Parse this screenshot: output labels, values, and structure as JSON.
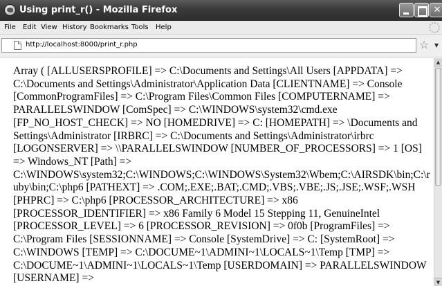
{
  "window": {
    "title": "Using print_r() - Mozilla Firefox"
  },
  "menu": {
    "items": [
      "File",
      "Edit",
      "View",
      "History",
      "Bookmarks",
      "Tools",
      "Help"
    ]
  },
  "address_bar": {
    "url": "http://localhost:8000/print_r.php"
  },
  "content": {
    "output": "Array ( [ALLUSERSPROFILE] => C:\\Documents and Settings\\All Users [APPDATA] => C:\\Documents and Settings\\Administrator\\Application Data [CLIENTNAME] => Console [CommonProgramFiles] => C:\\Program Files\\Common Files [COMPUTERNAME] => PARALLELSWINDOW [ComSpec] => C:\\WINDOWS\\system32\\cmd.exe [FP_NO_HOST_CHECK] => NO [HOMEDRIVE] => C: [HOMEPATH] => \\Documents and Settings\\Administrator [IRBRC] => C:\\Documents and Settings\\Administrator\\irbrc [LOGONSERVER] => \\\\PARALLELSWINDOW [NUMBER_OF_PROCESSORS] => 1 [OS] => Windows_NT [Path] => C:\\WINDOWS\\system32;C:\\WINDOWS;C:\\WINDOWS\\System32\\Wbem;C:\\AIRSDK\\bin;C:\\ruby\\bin;C:\\php6 [PATHEXT] => .COM;.EXE;.BAT;.CMD;.VBS;.VBE;.JS;.JSE;.WSF;.WSH [PHPRC] => C:\\php6 [PROCESSOR_ARCHITECTURE] => x86 [PROCESSOR_IDENTIFIER] => x86 Family 6 Model 15 Stepping 11, GenuineIntel [PROCESSOR_LEVEL] => 6 [PROCESSOR_REVISION] => 0f0b [ProgramFiles] => C:\\Program Files [SESSIONNAME] => Console [SystemDrive] => C: [SystemRoot] => C:\\WINDOWS [TEMP] => C:\\DOCUME~1\\ADMINI~1\\LOCALS~1\\Temp [TMP] => C:\\DOCUME~1\\ADMINI~1\\LOCALS~1\\Temp [USERDOMAIN] => PARALLELSWINDOW [USERNAME] =>"
  },
  "icons": {
    "app": "firefox-icon",
    "page": "page-icon",
    "bookmark": "star-icon",
    "dropdown": "chevron-down-icon"
  }
}
